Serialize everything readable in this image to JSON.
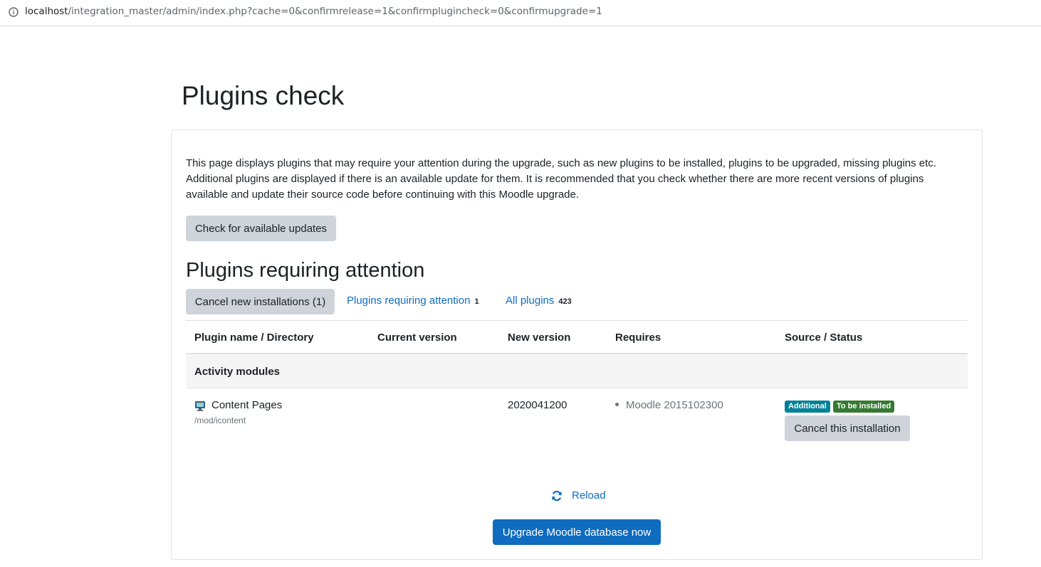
{
  "browser": {
    "url_host": "localhost",
    "url_path": "/integration_master/admin/index.php?cache=0&confirmrelease=1&confirmplugincheck=0&confirmupgrade=1"
  },
  "page": {
    "title": "Plugins check",
    "intro": "This page displays plugins that may require your attention during the upgrade, such as new plugins to be installed, plugins to be upgraded, missing plugins etc. Additional plugins are displayed if there is an available update for them. It is recommended that you check whether there are more recent versions of plugins available and update their source code before continuing with this Moodle upgrade.",
    "check_updates_label": "Check for available updates",
    "section_heading": "Plugins requiring attention"
  },
  "filters": {
    "cancel_new_label": "Cancel new installations (1)",
    "attention_label": "Plugins requiring attention",
    "attention_count": "1",
    "all_label": "All plugins",
    "all_count": "423"
  },
  "table": {
    "headers": {
      "name": "Plugin name / Directory",
      "current": "Current version",
      "new": "New version",
      "requires": "Requires",
      "status": "Source / Status"
    },
    "group": "Activity modules",
    "rows": [
      {
        "name": "Content Pages",
        "directory": "/mod/icontent",
        "current_version": "",
        "new_version": "2020041200",
        "requires": "Moodle 2015102300",
        "badge_source": "Additional",
        "badge_status": "To be installed",
        "action_label": "Cancel this installation",
        "icon": "module-icon"
      }
    ]
  },
  "footer": {
    "reload_label": "Reload",
    "reload_icon": "reload-icon",
    "upgrade_label": "Upgrade Moodle database now"
  },
  "colors": {
    "link": "#0f6cbf",
    "primary": "#0f6cbf",
    "badge_additional": "#008196",
    "badge_install": "#357a32",
    "secondary_button": "#ced4da"
  }
}
